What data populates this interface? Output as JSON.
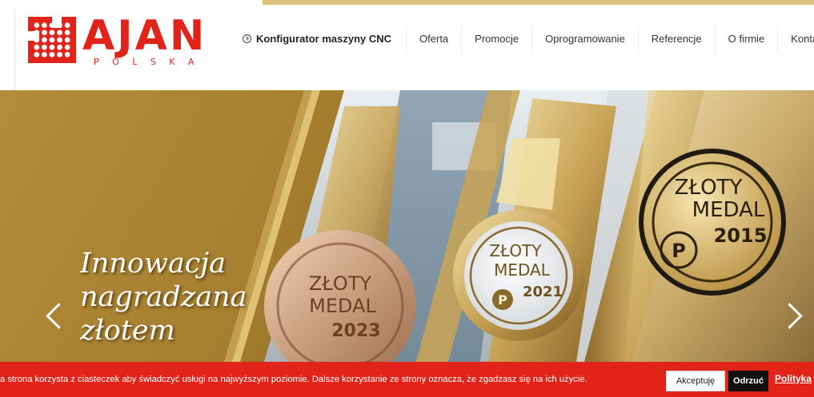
{
  "brand": {
    "name": "AJAN",
    "sub": "POLSKA",
    "color": "#e2231a"
  },
  "nav": {
    "configurator": "Konfigurator maszyny CNC",
    "items": [
      {
        "label": "Oferta"
      },
      {
        "label": "Promocje"
      },
      {
        "label": "Oprogramowanie"
      },
      {
        "label": "Referencje"
      },
      {
        "label": "O firmie"
      },
      {
        "label": "Kontakt"
      }
    ]
  },
  "hero": {
    "headline": "Innowacja\nnagradzana\nzłotem",
    "medals": [
      {
        "line1": "ZŁOTY",
        "line2": "MEDAL",
        "year": "2023"
      },
      {
        "line1": "ZŁOTY",
        "line2": "MEDAL",
        "year": "2021"
      },
      {
        "line1": "ZŁOTY",
        "line2": "MEDAL",
        "year": "2015"
      }
    ],
    "prev_icon": "chevron-left-icon",
    "next_icon": "chevron-right-icon"
  },
  "cookie": {
    "text": "a strona korzysta z ciasteczek aby świadczyć usługi na najwyższym poziomie. Dalsze korzystanie ze strony oznacza, że zgadzasz się na ich użycie.",
    "accept": "Akceptuję",
    "reject": "Odrzuć",
    "policy": "Polityka"
  },
  "colors": {
    "accent_red": "#e2231a",
    "gold": "#c29a45",
    "dark": "#111111"
  }
}
